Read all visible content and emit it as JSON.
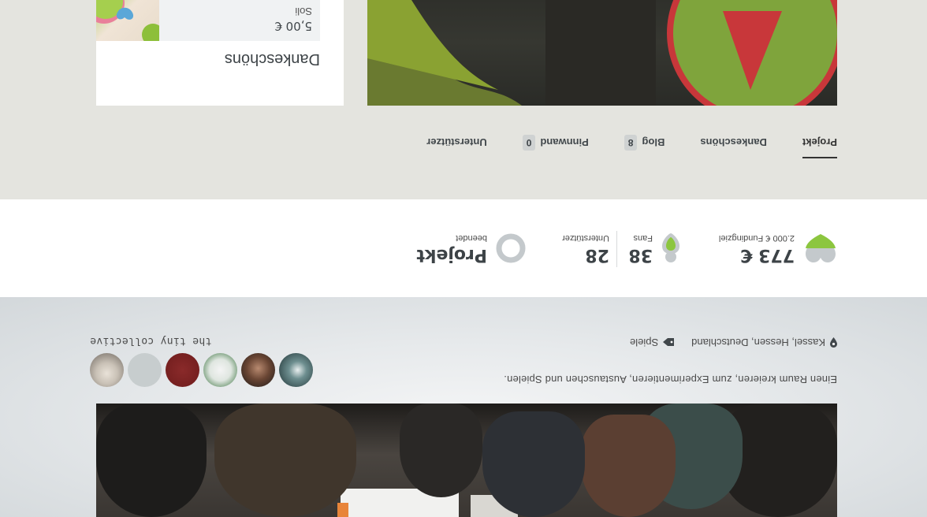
{
  "hero": {
    "tagline": "Einen Raum kreieren, zum Experimentieren, Austauschen und Spielen.",
    "location": "Kassel, Hessen, Deutschland",
    "category": "Spiele",
    "team_name": "the tiny collective"
  },
  "stats": {
    "funding_amount": "773 €",
    "funding_goal_label": "2.000 € Fundingziel",
    "fans_count": "38",
    "fans_label": "Fans",
    "supporters_count": "28",
    "supporters_label": "Unterstützer",
    "status_title": "Projekt",
    "status_label": "beendet"
  },
  "tabs": [
    {
      "label": "Projekt",
      "active": true
    },
    {
      "label": "Dankeschöns"
    },
    {
      "label": "Blog",
      "count": "8"
    },
    {
      "label": "Pinnwand",
      "count": "0"
    },
    {
      "label": "Unterstützer"
    }
  ],
  "sidebar": {
    "title": "Dankeschöns",
    "reward_price": "5,00 €",
    "reward_name": "Soli"
  },
  "colors": {
    "accent_green": "#8cc63f",
    "heart_gray": "#c4c9cc",
    "content_bg": "#e4e4df"
  },
  "icons": [
    "pin-icon",
    "tag-icon",
    "heart-icon",
    "fan-icon",
    "status-ring-icon"
  ]
}
